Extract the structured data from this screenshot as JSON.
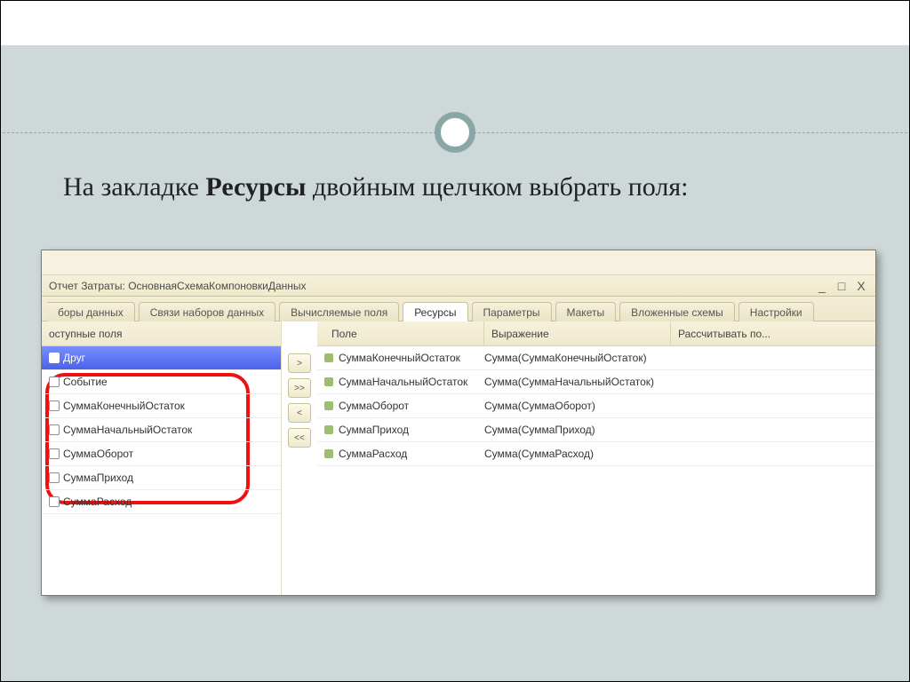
{
  "headline": {
    "pre": "На закладке ",
    "bold": "Ресурсы",
    "post": " двойным щелчком выбрать поля:"
  },
  "window": {
    "title": "Отчет Затраты: ОсновнаяСхемаКомпоновкиДанных"
  },
  "tabs": [
    {
      "label": "боры данных"
    },
    {
      "label": "Связи наборов данных"
    },
    {
      "label": "Вычисляемые поля"
    },
    {
      "label": "Ресурсы",
      "active": true
    },
    {
      "label": "Параметры"
    },
    {
      "label": "Макеты"
    },
    {
      "label": "Вложенные схемы"
    },
    {
      "label": "Настройки"
    }
  ],
  "leftHeader": "оступные поля",
  "availableFields": [
    {
      "label": "Друг",
      "selected": true
    },
    {
      "label": "Событие"
    },
    {
      "label": "СуммаКонечныйОстаток"
    },
    {
      "label": "СуммаНачальныйОстаток"
    },
    {
      "label": "СуммаОборот"
    },
    {
      "label": "СуммаПриход"
    },
    {
      "label": "СуммаРасход"
    }
  ],
  "rightHeaders": {
    "field": "Поле",
    "expr": "Выражение",
    "calc": "Рассчитывать по..."
  },
  "movers": {
    "right": ">",
    "rightAll": ">>",
    "left": "<",
    "leftAll": "<<"
  },
  "resources": [
    {
      "field": "СуммаКонечныйОстаток",
      "expr": "Сумма(СуммаКонечныйОстаток)"
    },
    {
      "field": "СуммаНачальныйОстаток",
      "expr": "Сумма(СуммаНачальныйОстаток)"
    },
    {
      "field": "СуммаОборот",
      "expr": "Сумма(СуммаОборот)"
    },
    {
      "field": "СуммаПриход",
      "expr": "Сумма(СуммаПриход)"
    },
    {
      "field": "СуммаРасход",
      "expr": "Сумма(СуммаРасход)"
    }
  ]
}
